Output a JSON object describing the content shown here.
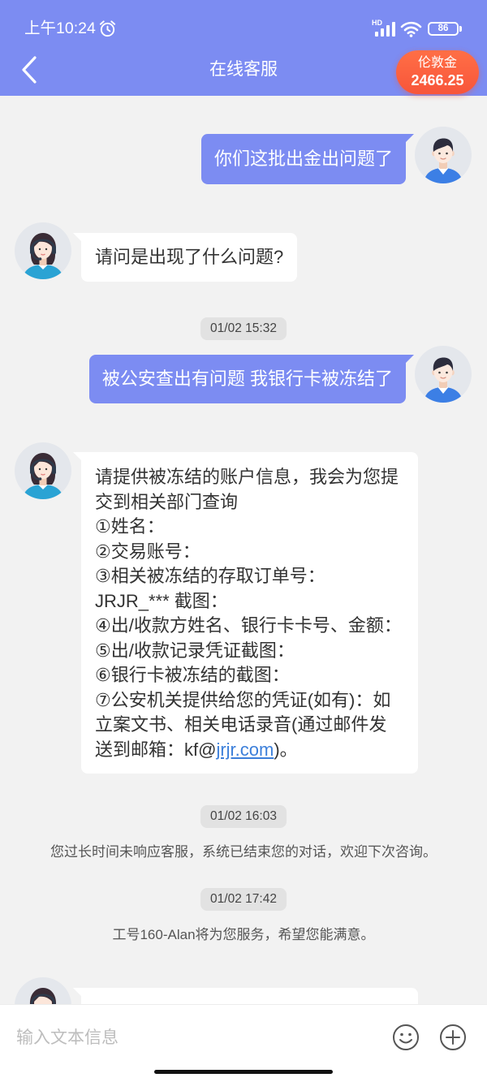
{
  "colors": {
    "header_bg": "#7C8CF2",
    "user_bubble_bg": "#7C8CF2",
    "badge_bg": "#F8553A",
    "chat_bg": "#F2F2F2",
    "link": "#3C7FDA"
  },
  "icons": {
    "status_alarm": "alarm-clock-icon",
    "status_signal": "signal-icon",
    "status_wifi": "wifi-icon",
    "status_battery": "battery-icon",
    "back": "chevron-left-icon",
    "emoji": "emoji-icon",
    "more": "plus-circle-icon"
  },
  "status_bar": {
    "time": "上午10:24",
    "network_type": "HD",
    "battery_level": "86"
  },
  "header": {
    "title": "在线客服",
    "badge_label": "伦敦金",
    "badge_value": "2466.25"
  },
  "chat": {
    "user_message_1": "你们这批出金出问题了",
    "agent_message_1": "请问是出现了什么问题?",
    "timestamp_1": "01/02 15:32",
    "user_message_2": "被公安查出有问题 我银行卡被冻结了",
    "agent_message_2": {
      "lines": [
        "请提供被冻结的账户信息，我会为您提",
        "交到相关部门查询",
        "①姓名：",
        "②交易账号：",
        "③相关被冻结的存取订单号：",
        "JRJR_*** 截图：",
        "④出/收款方姓名、银行卡卡号、金额：",
        "⑤出/收款记录凭证截图：",
        "⑥银行卡被冻结的截图：",
        "⑦公安机关提供给您的凭证(如有)：如",
        "立案文书、相关电话录音(通过邮件发"
      ],
      "last_line_text": "送到邮箱：kf@",
      "last_line_link": "jrjr.com",
      "last_line_end": ")。"
    },
    "timestamp_2": "01/02 16:03",
    "system_notice_1": "您过长时间未响应客服，系统已结束您的对话，欢迎下次咨询。",
    "timestamp_3": "01/02 17:42",
    "system_notice_2": "工号160-Alan将为您服务，希望您能满意。"
  },
  "input_bar": {
    "placeholder": "输入文本信息"
  }
}
